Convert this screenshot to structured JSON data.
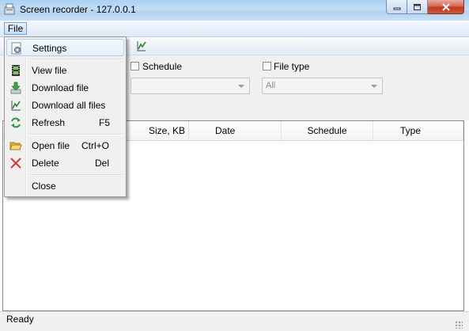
{
  "window": {
    "title": "Screen recorder - 127.0.0.1"
  },
  "menubar": {
    "file": "File"
  },
  "filters": {
    "schedule_label": "Schedule",
    "schedule_value": "",
    "filetype_label": "File type",
    "filetype_value": "All"
  },
  "table": {
    "columns": [
      "Size, KB",
      "Date",
      "Schedule",
      "Type"
    ],
    "rows": []
  },
  "status": {
    "text": "Ready"
  },
  "file_menu": {
    "items": [
      {
        "label": "Settings",
        "shortcut": "",
        "icon": "settings-icon"
      },
      {
        "label": "View file",
        "shortcut": "",
        "icon": "film-icon"
      },
      {
        "label": "Download file",
        "shortcut": "",
        "icon": "download-icon"
      },
      {
        "label": "Download all files",
        "shortcut": "",
        "icon": "download-all-icon"
      },
      {
        "label": "Refresh",
        "shortcut": "F5",
        "icon": "refresh-icon"
      },
      {
        "label": "Open file",
        "shortcut": "Ctrl+O",
        "icon": "folder-icon"
      },
      {
        "label": "Delete",
        "shortcut": "Del",
        "icon": "delete-icon"
      },
      {
        "label": "Close",
        "shortcut": "",
        "icon": ""
      }
    ]
  }
}
